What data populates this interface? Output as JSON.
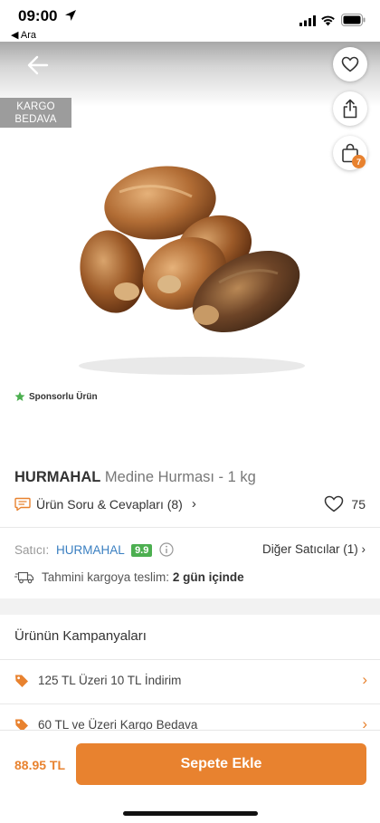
{
  "status_bar": {
    "time": "09:00",
    "back_app_label": "◀ Ara",
    "icons": [
      "location-arrow-icon",
      "signal-icon",
      "wifi-icon",
      "battery-icon"
    ]
  },
  "hero": {
    "badge_line1": "KARGO",
    "badge_line2": "BEDAVA",
    "cart_count": "7",
    "sponsored_label": "Sponsorlu Ürün",
    "icons": [
      "back-arrow-icon",
      "heart-icon",
      "share-icon",
      "shopping-bag-icon"
    ]
  },
  "product": {
    "brand": "HURMAHAL",
    "name": "Medine Hurması - 1 kg",
    "qa_label": "Ürün Soru & Cevapları (8)",
    "like_count": "75"
  },
  "seller": {
    "label": "Satıcı:",
    "name": "HURMAHAL",
    "score": "9.9",
    "other_sellers": "Diğer Satıcılar (1)"
  },
  "delivery": {
    "label": "Tahmini kargoya teslim:",
    "value": "2 gün içinde"
  },
  "campaigns": {
    "title": "Ürünün Kampanyaları",
    "items": [
      {
        "label": "125 TL Üzeri 10 TL İndirim"
      },
      {
        "label": "60 TL ve Üzeri Kargo Bedava"
      }
    ]
  },
  "bottom_bar": {
    "price": "88.95 TL",
    "add_to_cart_label": "Sepete Ekle"
  },
  "colors": {
    "accent": "#e8822f",
    "seller_link": "#3a7fc1",
    "score_badge": "#4caf50",
    "sponsored_star": "#4caf50"
  }
}
